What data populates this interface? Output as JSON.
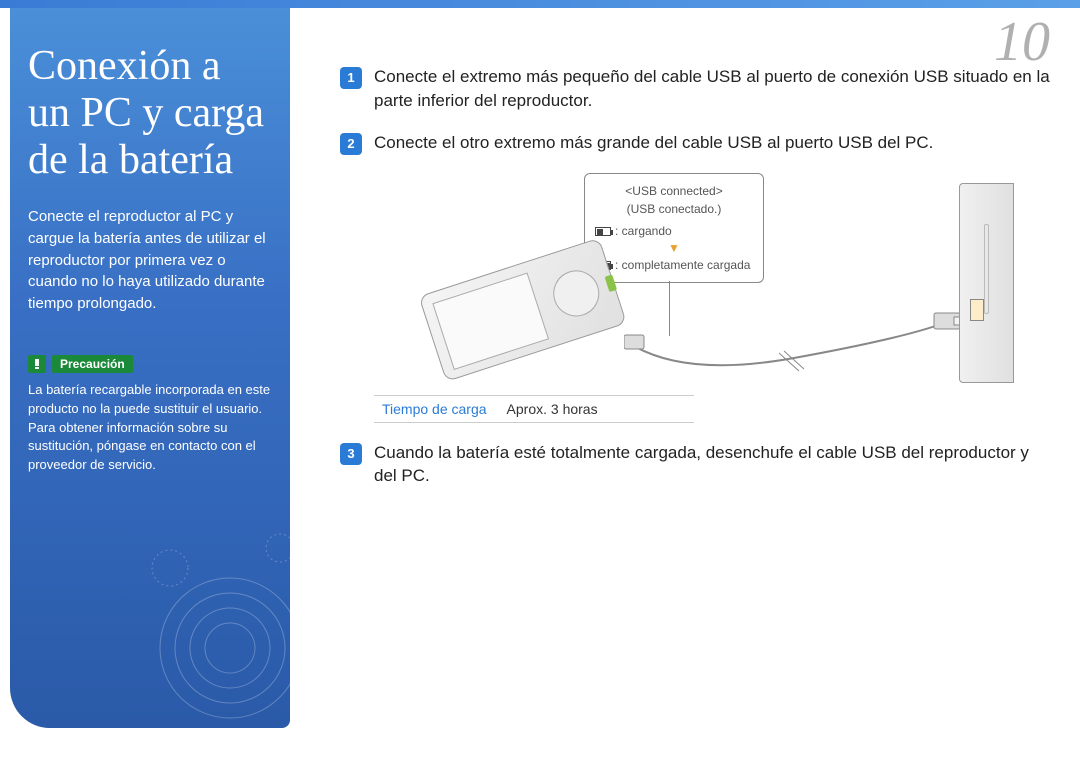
{
  "page_number": "10",
  "sidebar": {
    "title": "Conexión a un PC y carga de la batería",
    "intro": "Conecte el reproductor al PC y cargue la batería antes de utilizar el reproductor por primera vez o cuando no lo haya utilizado durante tiempo prolongado.",
    "caution_label": "Precaución",
    "caution_text": "La batería recargable incorporada en este producto no la puede sustituir el usuario. Para obtener información sobre su sustitución, póngase en contacto con el proveedor de servicio."
  },
  "steps": {
    "s1": "Conecte el extremo más pequeño del cable USB al puerto de conexión USB situado en la parte inferior del reproductor.",
    "s2": "Conecte el otro extremo más grande del cable USB al puerto USB del PC.",
    "s3": "Cuando la batería esté totalmente cargada, desenchufe el cable USB del reproductor y del PC."
  },
  "callout": {
    "line1": "<USB connected>",
    "line2": "(USB conectado.)",
    "charging": ": cargando",
    "full": ": completamente cargada"
  },
  "charge": {
    "label": "Tiempo de carga",
    "value": "Aprox. 3 horas"
  }
}
